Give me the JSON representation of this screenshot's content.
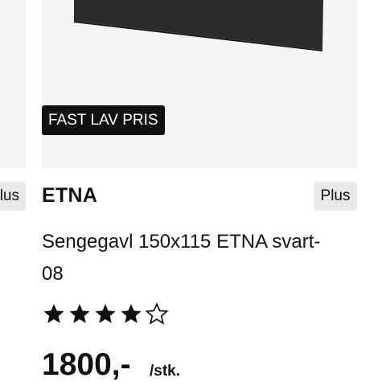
{
  "product": {
    "badge": "FAST LAV PRIS",
    "brand": "ETNA",
    "plus_badge": "Plus",
    "description": "Sengegavl 150x115 ETNA svart-08",
    "rating": 4,
    "rating_max": 5,
    "price": "1800,-",
    "unit": "/stk."
  },
  "previous_card": {
    "plus_badge": "Plus"
  },
  "colors": {
    "image_background": "#f5f5f5",
    "headboard": "#2b2b2b",
    "badge_background": "#111111",
    "plus_background": "#e9e9e9"
  }
}
